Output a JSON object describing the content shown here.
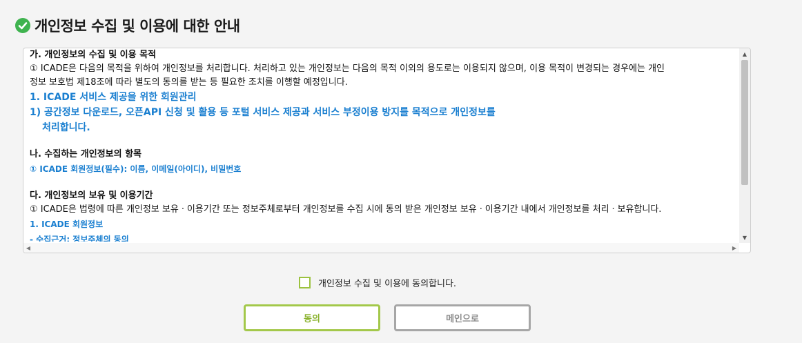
{
  "header": {
    "title": "개인정보 수집 및 이용에 대한 안내",
    "icon": "check-circle-icon",
    "icon_color": "#3fb34f"
  },
  "terms": {
    "section1_title": "가. 개인정보의 수집 및 이용 목적",
    "section1_body_line1": "① ICADE은 다음의 목적을 위하여 개인정보를 처리합니다. 처리하고 있는 개인정보는 다음의 목적 이외의 용도로는 이용되지 않으며, 이용 목적이 변경되는 경우에는 개인",
    "section1_body_line2": "정보 보호법 제18조에 따라 별도의 동의를 받는 등 필요한 조치를 이행할 예정입니다.",
    "section1_item1": "1. ICADE 서비스 제공을 위한 회원관리",
    "section1_item2_line1": "1) 공간정보 다운로드, 오픈API 신청 및 활용 등 포털 서비스 제공과 서비스 부정이용 방지를 목적으로 개인정보를",
    "section1_item2_line2": "처리합니다.",
    "section2_title": "나. 수집하는 개인정보의 항목",
    "section2_item1": "① ICADE 회원정보(필수): 이름, 이메일(아이디), 비밀번호",
    "section3_title": "다. 개인정보의 보유 및 이용기간",
    "section3_body": "① ICADE은 법령에 따른 개인정보 보유ㆍ이용기간 또는 정보주체로부터 개인정보를 수집 시에 동의 받은 개인정보 보유ㆍ이용기간 내에서 개인정보를 처리ㆍ보유합니다.",
    "section3_item1": "1. ICADE 회원정보",
    "section3_item2": "- 수집근거: 정보주체의 동의"
  },
  "agreement": {
    "checkbox_label": "개인정보 수집 및 이용에 동의합니다.",
    "checked": false
  },
  "buttons": {
    "agree_label": "동의",
    "main_label": "메인으로"
  },
  "colors": {
    "accent_green": "#a3c84a",
    "link_blue": "#1a7fd0",
    "secondary_gray": "#a6a6a6"
  }
}
